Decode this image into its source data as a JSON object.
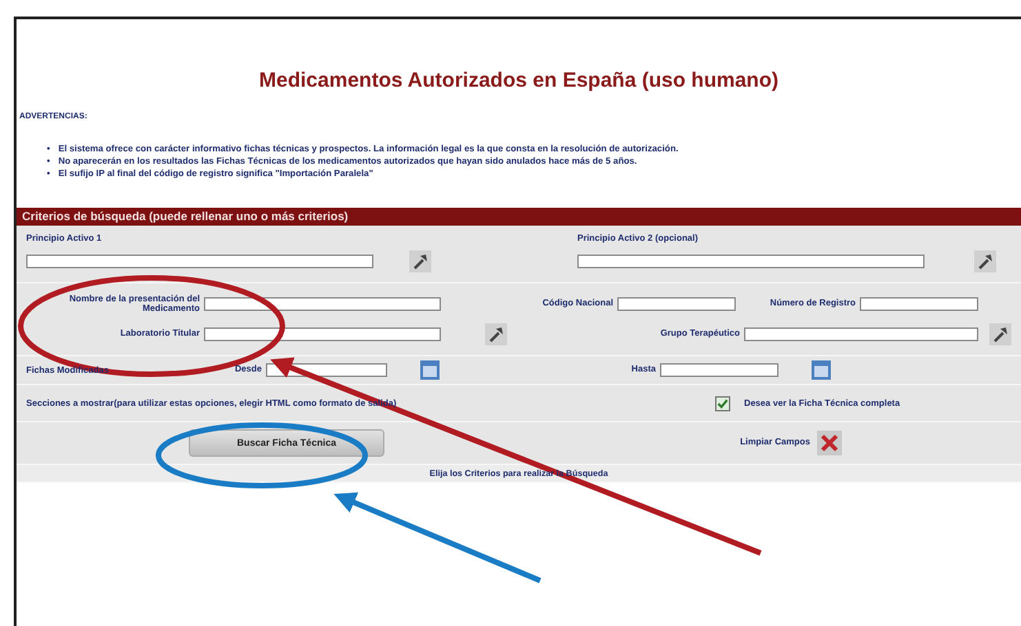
{
  "page": {
    "title": "Medicamentos Autorizados en España (uso humano)",
    "warnings_label": "ADVERTENCIAS:",
    "bullet": "•",
    "warnings": [
      "El sistema ofrece con carácter informativo fichas técnicas y prospectos. La información legal es la que consta en la resolución de autorización.",
      "No aparecerán en los resultados las Fichas Técnicas de los medicamentos autorizados que hayan sido anulados hace más de 5 años.",
      "El sufijo IP al final del código de registro significa \"Importación Paralela\""
    ]
  },
  "criteria": {
    "header": "Criterios de búsqueda (puede rellenar uno o más criterios)",
    "principio_1": "Principio Activo 1",
    "principio_2": "Principio Activo 2 (opcional)",
    "nombre": "Nombre de la presentación del Medicamento",
    "codigo_nacional": "Código Nacional",
    "numero_registro": "Número de Registro",
    "laboratorio": "Laboratorio Titular",
    "grupo": "Grupo Terapéutico",
    "fichas_modificadas": "Fichas Modificadas",
    "desde": "Desde",
    "hasta": "Hasta",
    "secciones": "Secciones a mostrar(para utilizar estas opciones, elegir HTML como formato de salida)",
    "ficha_completa": {
      "label": "Desea ver la Ficha Técnica completa",
      "checked": true
    },
    "search_button": "Buscar Ficha Técnica",
    "clear": "Limpiar Campos",
    "status": "Elija los Criterios para realizar la Búsqueda"
  },
  "annotations": [
    {
      "kind": "ellipse",
      "color": "#b01c22"
    },
    {
      "kind": "arrow",
      "color": "#b01c22"
    },
    {
      "kind": "ellipse",
      "color": "#1a7cc4"
    },
    {
      "kind": "arrow",
      "color": "#1a7cc4"
    }
  ]
}
